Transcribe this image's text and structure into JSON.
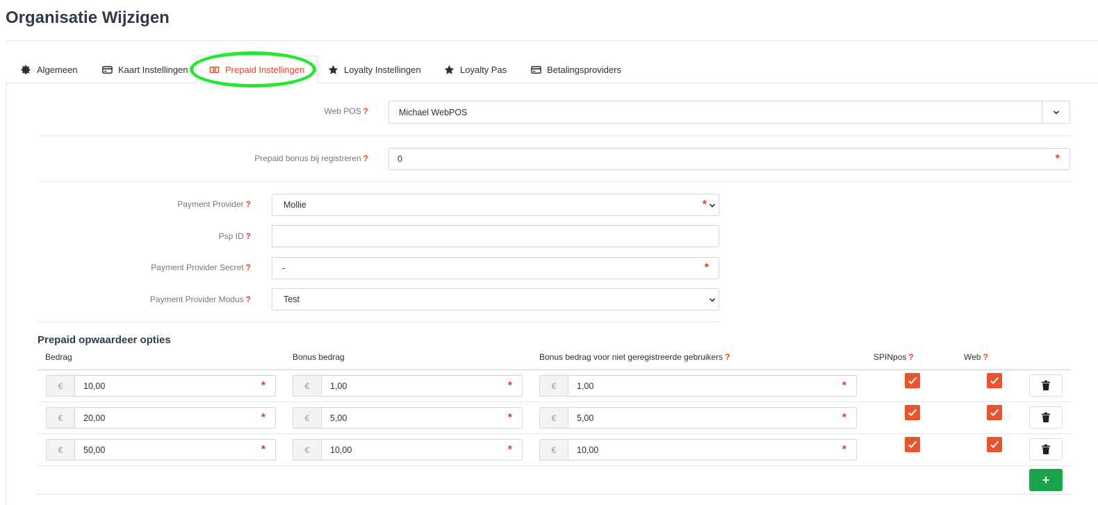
{
  "page": {
    "title": "Organisatie Wijzigen"
  },
  "tabs": [
    {
      "label": "Algemeen",
      "icon": "gear-icon"
    },
    {
      "label": "Kaart Instellingen",
      "icon": "card-icon"
    },
    {
      "label": "Prepaid Instellingen",
      "icon": "cash-icon",
      "active": true
    },
    {
      "label": "Loyalty Instellingen",
      "icon": "star-icon"
    },
    {
      "label": "Loyalty Pas",
      "icon": "star-icon"
    },
    {
      "label": "Betalingsproviders",
      "icon": "card-icon"
    }
  ],
  "form": {
    "help_mark": "?",
    "required_mark": "*",
    "web_pos": {
      "label": "Web POS",
      "value": "Michael WebPOS"
    },
    "prepaid_bonus": {
      "label": "Prepaid bonus bij registreren",
      "value": "0"
    },
    "payment_provider": {
      "label": "Payment Provider",
      "value": "Mollie"
    },
    "psp_id": {
      "label": "Psp ID",
      "value": ""
    },
    "provider_secret": {
      "label": "Payment Provider Secret",
      "value": "-"
    },
    "provider_mode": {
      "label": "Payment Provider Modus",
      "value": "Test"
    }
  },
  "topup": {
    "title": "Prepaid opwaardeer opties",
    "currency_symbol": "€",
    "columns": {
      "amount": "Bedrag",
      "bonus": "Bonus bedrag",
      "bonus_unregistered": "Bonus bedrag voor niet geregistreerde gebruikers",
      "spinpos": "SPINpos",
      "web": "Web"
    },
    "rows": [
      {
        "amount": "10,00",
        "bonus": "1,00",
        "bonus_unregistered": "1,00",
        "spinpos": true,
        "web": true
      },
      {
        "amount": "20,00",
        "bonus": "5,00",
        "bonus_unregistered": "5,00",
        "spinpos": true,
        "web": true
      },
      {
        "amount": "50,00",
        "bonus": "10,00",
        "bonus_unregistered": "10,00",
        "spinpos": true,
        "web": true
      }
    ],
    "add_label": "+"
  },
  "colors": {
    "accent": "#e0442a",
    "checkbox": "#e8542e",
    "add_button": "#1aa34a",
    "highlight_ring": "#22e82e"
  }
}
